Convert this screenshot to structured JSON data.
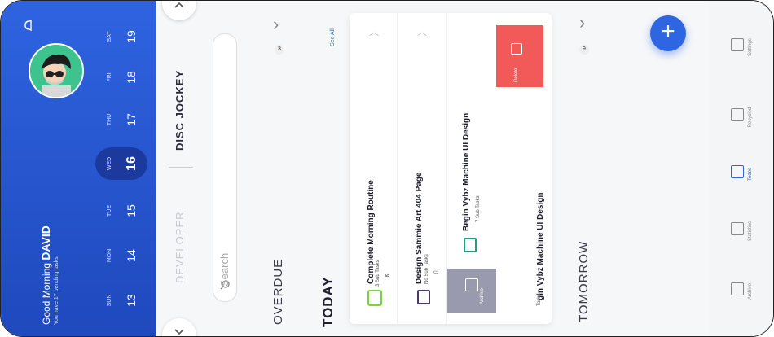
{
  "header": {
    "greeting": "Good Morning",
    "name": "DAVID",
    "pending": "You have 17 pending tasks"
  },
  "calendar": [
    {
      "dow": "SUN",
      "num": "13"
    },
    {
      "dow": "MON",
      "num": "14"
    },
    {
      "dow": "TUE",
      "num": "15"
    },
    {
      "dow": "WED",
      "num": "16",
      "selected": true
    },
    {
      "dow": "THU",
      "num": "17"
    },
    {
      "dow": "FRI",
      "num": "18"
    },
    {
      "dow": "SAT",
      "num": "19"
    }
  ],
  "categories": {
    "active": "DISC JOCKEY",
    "inactive": "DEVELOPER"
  },
  "search": {
    "placeholder": "Search"
  },
  "overdue": {
    "label": "OVERDUE",
    "count": "3"
  },
  "today": {
    "label": "TODAY",
    "see_all": "See All",
    "tasks": [
      {
        "title": "Complete Morning Routine",
        "sub": "3 Sub Tasks"
      },
      {
        "title": "Design Sammie Art 404 Page",
        "sub": "No Sub Tasks"
      },
      {
        "title": "Begin Vybz Machine UI Design",
        "sub": "7 Sub Tasks"
      }
    ],
    "swiped_title": "gin Vybz Machine UI Design",
    "swiped_sub": "Tasks",
    "archive": "Archive",
    "delete": "Delete"
  },
  "tomorrow": {
    "label": "TOMORROW",
    "count": "9"
  },
  "nav": [
    {
      "label": "Settings",
      "icon": "bell-icon"
    },
    {
      "label": "Recycled",
      "icon": "trash-icon"
    },
    {
      "label": "Todos",
      "icon": "todo-icon",
      "active": true
    },
    {
      "label": "Statistics",
      "icon": "stats-icon"
    },
    {
      "label": "Archive",
      "icon": "archive-icon"
    }
  ],
  "colors": {
    "accent": "#2d66e0",
    "delete": "#f25a5a",
    "archive": "#9a9aae",
    "green_icon": "#7ad33a"
  }
}
